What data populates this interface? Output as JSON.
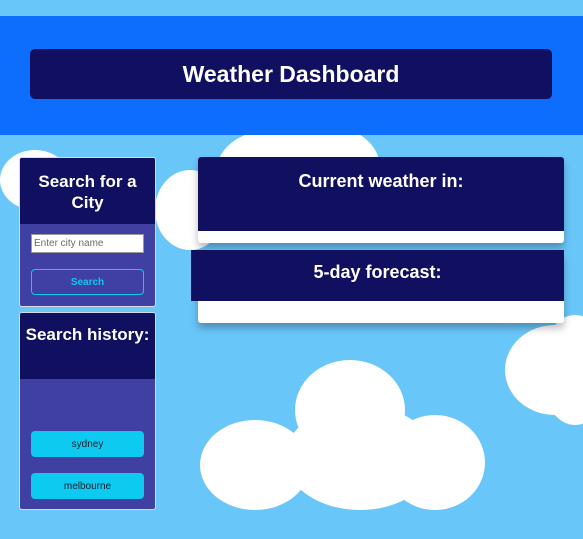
{
  "header": {
    "title": "Weather Dashboard"
  },
  "search": {
    "title": "Search for a City",
    "input_placeholder": "Enter city name",
    "input_value": "",
    "button_label": "Search"
  },
  "history": {
    "title": "Search history:",
    "items": [
      {
        "label": "sydney"
      },
      {
        "label": "melbourne"
      }
    ]
  },
  "current": {
    "title": "Current weather in:"
  },
  "forecast": {
    "title": "5-day forecast:"
  },
  "colors": {
    "sky": "#69c6f9",
    "header_bar": "#0d6efd",
    "navy": "#110f5f",
    "panel_purple": "#4040a3",
    "cyan": "#0dcaf0"
  }
}
